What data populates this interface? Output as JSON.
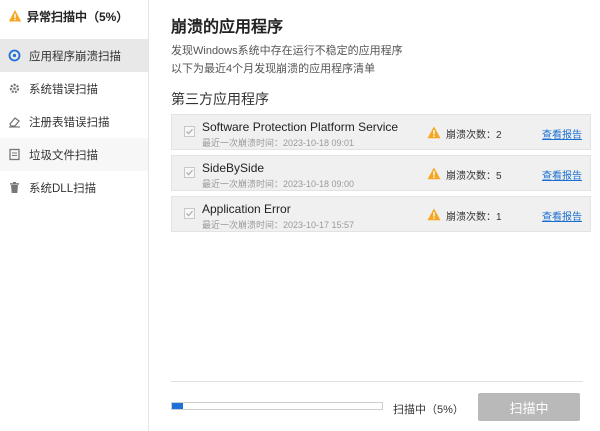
{
  "sidebar": {
    "header": "异常扫描中（5%）",
    "items": [
      {
        "label": "应用程序崩溃扫描",
        "icon": "circle-scan-icon"
      },
      {
        "label": "系统错误扫描",
        "icon": "gear-icon"
      },
      {
        "label": "注册表错误扫描",
        "icon": "eraser-icon"
      },
      {
        "label": "垃圾文件扫描",
        "icon": "document-icon"
      },
      {
        "label": "系统DLL扫描",
        "icon": "trash-icon"
      }
    ]
  },
  "main": {
    "title": "崩溃的应用程序",
    "desc1": "发现Windows系统中存在运行不稳定的应用程序",
    "desc2": "以下为最近4个月发现崩溃的应用程序清单",
    "section_title": "第三方应用程序",
    "apps": [
      {
        "name": "Software Protection Platform Service",
        "time": "最近一次崩溃时间：2023-10-18 09:01",
        "count": "崩溃次数：2",
        "report": "查看报告"
      },
      {
        "name": "SideBySide",
        "time": "最近一次崩溃时间：2023-10-18 09:00",
        "count": "崩溃次数：5",
        "report": "查看报告"
      },
      {
        "name": "Application Error",
        "time": "最近一次崩溃时间：2023-10-17 15:57",
        "count": "崩溃次数：1",
        "report": "查看报告"
      }
    ]
  },
  "footer": {
    "progress_label": "扫描中（5%）",
    "progress_fraction": 0.05,
    "scan_button": "扫描中"
  },
  "colors": {
    "accent": "#1f6fd6",
    "warning": "#f5a623",
    "link": "#1a6fd1",
    "button_disabled": "#b9b9b9"
  }
}
